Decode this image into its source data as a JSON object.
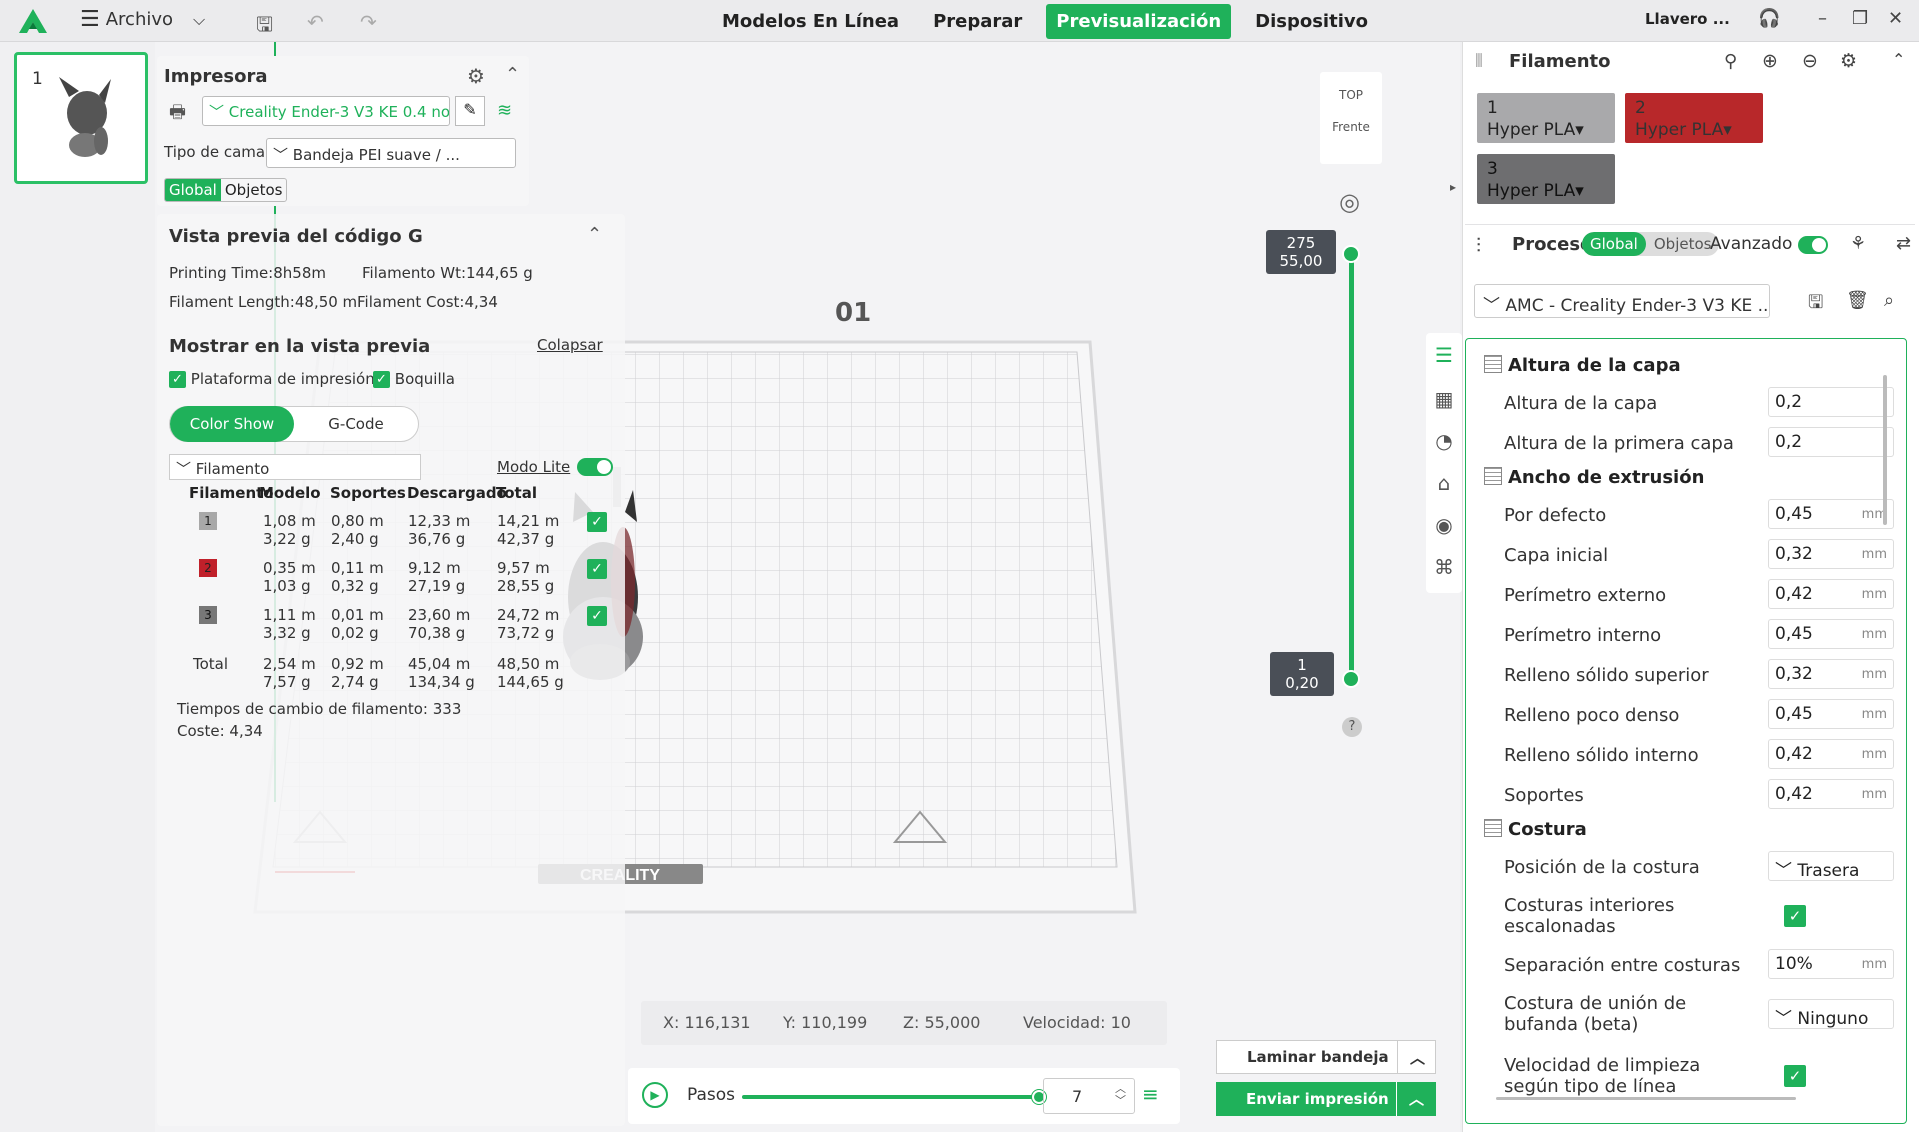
{
  "topbar": {
    "menu_label": "Archivo",
    "tabs": [
      "Modelos En Línea",
      "Preparar",
      "Previsualización",
      "Dispositivo"
    ],
    "active_tab": "Previsualización",
    "user": "Llavero ..."
  },
  "plate": {
    "number": "1"
  },
  "printer_panel": {
    "title": "Impresora",
    "printer": "Creality Ender-3 V3 KE 0.4 no...",
    "bed_label": "Tipo de cama",
    "bed_value": "Bandeja PEI suave / ...",
    "seg_global": "Global",
    "seg_objects": "Objetos"
  },
  "gcode_panel": {
    "title": "Vista previa del código G",
    "printing_time": "Printing Time:8h58m",
    "filament_wt": "Filamento Wt:144,65 g",
    "filament_length": "Filament Length:48,50 m",
    "filament_cost": "Filament Cost:4,34",
    "show_title": "Mostrar en la vista previa",
    "collapse": "Colapsar",
    "cb_platform": "Plataforma de impresión",
    "cb_nozzle": "Boquilla",
    "mode_color": "Color Show",
    "mode_gcode": "G-Code",
    "filament_select": "Filamento",
    "modo_lite": "Modo Lite",
    "headers": [
      "Filamento",
      "Modelo",
      "Soportes",
      "Descargado",
      "Total"
    ],
    "rows": [
      {
        "id": "1",
        "color": "#a8a8a8",
        "modelo": [
          "1,08 m",
          "3,22 g"
        ],
        "soportes": [
          "0,80 m",
          "2,40 g"
        ],
        "descargado": [
          "12,33 m",
          "36,76 g"
        ],
        "total": [
          "14,21 m",
          "42,37 g"
        ]
      },
      {
        "id": "2",
        "color": "#c0202a",
        "modelo": [
          "0,35 m",
          "1,03 g"
        ],
        "soportes": [
          "0,11 m",
          "0,32 g"
        ],
        "descargado": [
          "9,12 m",
          "27,19 g"
        ],
        "total": [
          "9,57 m",
          "28,55 g"
        ]
      },
      {
        "id": "3",
        "color": "#777777",
        "modelo": [
          "1,11 m",
          "3,32 g"
        ],
        "soportes": [
          "0,01 m",
          "0,02 g"
        ],
        "descargado": [
          "23,60 m",
          "70,38 g"
        ],
        "total": [
          "24,72 m",
          "73,72 g"
        ]
      }
    ],
    "total_label": "Total",
    "total_row": {
      "modelo": [
        "2,54 m",
        "7,57 g"
      ],
      "soportes": [
        "0,92 m",
        "2,74 g"
      ],
      "descargado": [
        "45,04 m",
        "134,34 g"
      ],
      "total": [
        "48,50 m",
        "144,65 g"
      ]
    },
    "change_times": "Tiempos de cambio de filamento:  333",
    "cost": "Coste:  4,34"
  },
  "viewport": {
    "view_top": "TOP",
    "view_front": "Frente",
    "plate_label": "01",
    "layer_top": [
      "275",
      "55,00"
    ],
    "layer_bottom": [
      "1",
      "0,20"
    ],
    "help": "?"
  },
  "coords": {
    "x": "X: 116,131",
    "y": "Y: 110,199",
    "z": "Z: 55,000",
    "speed": "Velocidad: 10"
  },
  "steps": {
    "label": "Pasos",
    "value": "7"
  },
  "actions": {
    "slice": "Laminar bandeja",
    "send": "Enviar impresión"
  },
  "filament_panel": {
    "title": "Filamento",
    "cards": [
      {
        "n": "1",
        "name": "Hyper PLA",
        "color": "#a9a9ab",
        "text": "#222"
      },
      {
        "n": "2",
        "name": "Hyper PLA",
        "color": "#b8282a",
        "text": "#333"
      },
      {
        "n": "3",
        "name": "Hyper PLA",
        "color": "#6e6e70",
        "text": "#111"
      }
    ]
  },
  "process_panel": {
    "title": "Proceso",
    "seg_global": "Global",
    "seg_objects": "Objetos",
    "advanced": "Avanzado",
    "profile": "AMC - Creality Ender-3 V3 KE ..."
  },
  "settings": {
    "groups": {
      "layer_height": "Altura de la capa",
      "extrusion_width": "Ancho de extrusión",
      "seam": "Costura"
    },
    "layer_rows": [
      {
        "label": "Altura de la capa",
        "value": "0,2",
        "unit": ""
      },
      {
        "label": "Altura de la primera capa",
        "value": "0,2",
        "unit": ""
      }
    ],
    "width_rows": [
      {
        "label": "Por defecto",
        "value": "0,45",
        "unit": "mm"
      },
      {
        "label": "Capa inicial",
        "value": "0,32",
        "unit": "mm"
      },
      {
        "label": "Perímetro externo",
        "value": "0,42",
        "unit": "mm"
      },
      {
        "label": "Perímetro interno",
        "value": "0,45",
        "unit": "mm"
      },
      {
        "label": "Relleno sólido superior",
        "value": "0,32",
        "unit": "mm"
      },
      {
        "label": "Relleno poco denso",
        "value": "0,45",
        "unit": "mm"
      },
      {
        "label": "Relleno sólido interno",
        "value": "0,42",
        "unit": "mm"
      },
      {
        "label": "Soportes",
        "value": "0,42",
        "unit": "mm"
      }
    ],
    "seam_position_label": "Posición de la costura",
    "seam_position_value": "Trasera",
    "staggered_label": "Costuras interiores escalonadas",
    "gap_label": "Separación entre costuras",
    "gap_value": "10%",
    "gap_unit": "mm",
    "scarf_label": "Costura de unión de bufanda (beta)",
    "scarf_value": "Ninguno",
    "wipe_label": "Velocidad de limpieza según tipo de línea"
  },
  "colors": {
    "accent": "#1fb15a"
  }
}
